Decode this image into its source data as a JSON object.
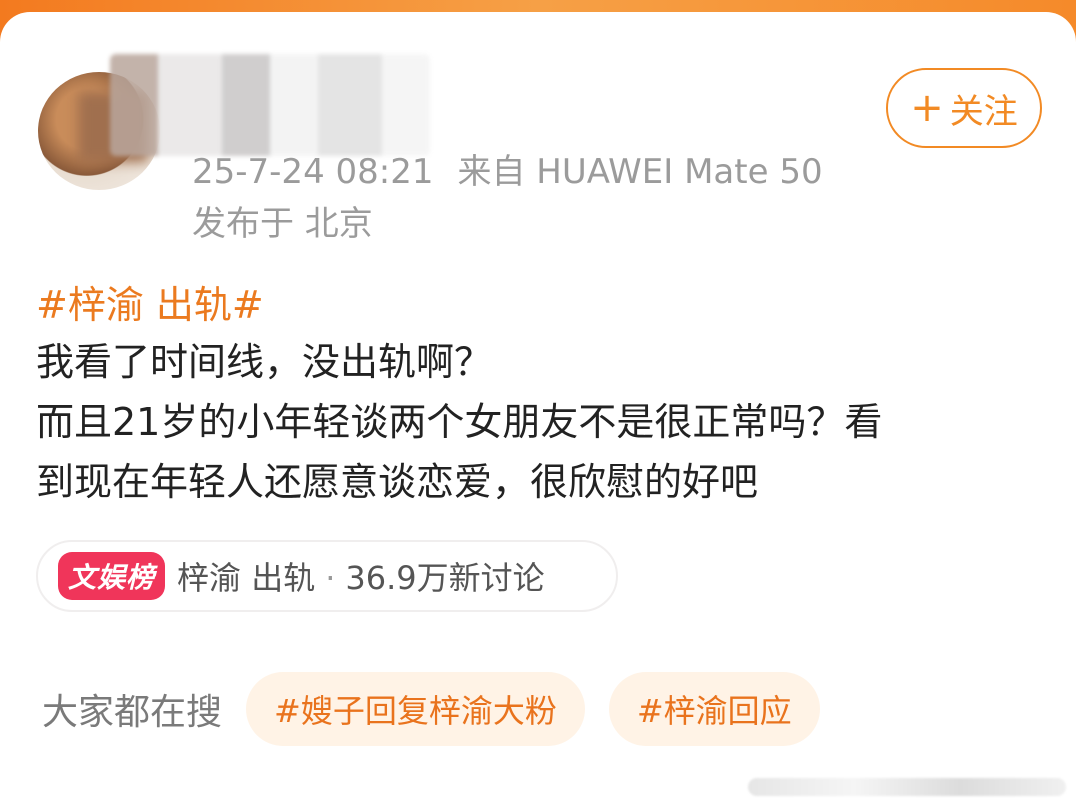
{
  "post": {
    "timestamp": "25-7-24 08:21",
    "source": "来自 HUAWEI Mate 50",
    "location": "发布于 北京",
    "follow_label": "关注",
    "hashtag": "#梓渝 出轨#",
    "body_lines": [
      "我看了时间线，没出轨啊？",
      "而且21岁的小年轻谈两个女朋友不是很正常吗？看",
      "到现在年轻人还愿意谈恋爱，很欣慰的好吧"
    ]
  },
  "trend": {
    "badge": "文娱榜",
    "topic": "梓渝 出轨",
    "separator": "·",
    "discussion": "36.9万新讨论"
  },
  "search": {
    "label": "大家都在搜",
    "tags": [
      "#嫂子回复梓渝大粉",
      "#梓渝回应"
    ]
  },
  "colors": {
    "accent": "#f28a24",
    "badge": "#f0355a",
    "tag_bg": "#fff3e6"
  }
}
